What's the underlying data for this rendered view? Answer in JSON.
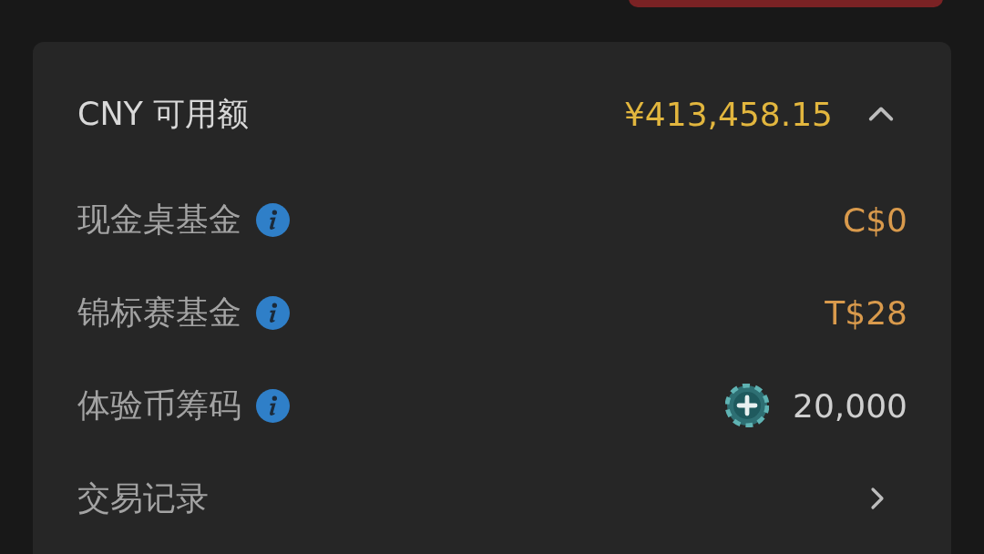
{
  "header": {
    "label": "CNY 可用额",
    "amount": "¥413,458.15",
    "expanded": true
  },
  "rows": [
    {
      "kind": "fund",
      "label": "现金桌基金",
      "value": "C$0"
    },
    {
      "kind": "fund",
      "label": "锦标赛基金",
      "value": "T$28"
    },
    {
      "kind": "chips",
      "label": "体验币筹码",
      "value": "20,000"
    },
    {
      "kind": "link",
      "label": "交易记录"
    }
  ]
}
